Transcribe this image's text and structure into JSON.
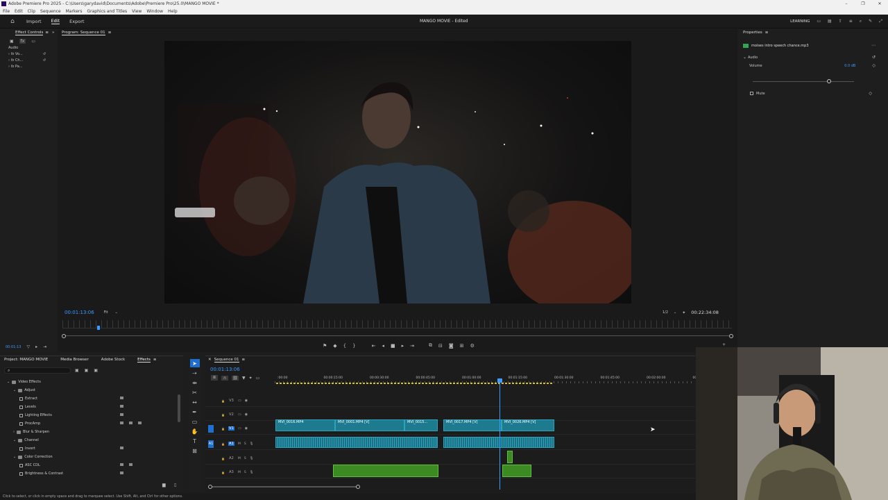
{
  "window": {
    "title": "Adobe Premiere Pro 2025 - C:\\Users\\garydavid\\Documents\\Adobe\\Premiere Pro\\25.0\\MANGO MOVIE *"
  },
  "menu": [
    "File",
    "Edit",
    "Clip",
    "Sequence",
    "Markers",
    "Graphics and Titles",
    "View",
    "Window",
    "Help"
  ],
  "workspace": {
    "tabs": [
      "Import",
      "Edit",
      "Export"
    ],
    "active_tab": "Edit",
    "project_title": "MANGO MOVIE - Edited",
    "learning_label": "LEARNING"
  },
  "effect_controls": {
    "tab_label": "Effect Controls",
    "section_audio": "Audio",
    "items": [
      "Vo...",
      "Ch...",
      "Pa..."
    ],
    "timecode": "00:01:13"
  },
  "program_monitor": {
    "tab_label": "Program: Sequence 01",
    "timecode_current": "00:01:13:06",
    "fit_label": "Fit",
    "resolution_label": "1/2",
    "timecode_duration": "00:22:34:08"
  },
  "properties": {
    "tab_label": "Properties",
    "file_name": "moises intro speech chance.mp3",
    "section_audio": "Audio",
    "volume_label": "Volume",
    "volume_value": "0.0 dB",
    "volume_level_fraction": 0.75,
    "mute_label": "Mute"
  },
  "project_panel": {
    "tabs": [
      "Project: MANGO MOVIE",
      "Media Browser",
      "Adobe Stock",
      "Effects"
    ],
    "active_tab": "Effects",
    "tree": [
      {
        "label": "Video Effects",
        "level": 0,
        "type": "folder"
      },
      {
        "label": "Adjust",
        "level": 1,
        "type": "folder"
      },
      {
        "label": "Extract",
        "level": 2,
        "type": "effect"
      },
      {
        "label": "Levels",
        "level": 2,
        "type": "effect"
      },
      {
        "label": "Lighting Effects",
        "level": 2,
        "type": "effect"
      },
      {
        "label": "ProcAmp",
        "level": 2,
        "type": "effect"
      },
      {
        "label": "Blur & Sharpen",
        "level": 1,
        "type": "folder"
      },
      {
        "label": "Channel",
        "level": 1,
        "type": "folder"
      },
      {
        "label": "Invert",
        "level": 2,
        "type": "effect"
      },
      {
        "label": "Color Correction",
        "level": 1,
        "type": "folder"
      },
      {
        "label": "ASC CDL",
        "level": 2,
        "type": "effect"
      },
      {
        "label": "Brightness & Contrast",
        "level": 2,
        "type": "effect"
      }
    ]
  },
  "timeline": {
    "tab_label": "Sequence 01",
    "timecode": "00:01:13:06",
    "ruler": [
      ":00:00",
      "00:00:15:00",
      "00:00:30:00",
      "00:00:45:00",
      "00:01:00:00",
      "00:01:15:00",
      "00:01:30:00",
      "00:01:45:00",
      "00:02:00:00",
      "00:02:15"
    ],
    "tracks": [
      "V3",
      "V2",
      "V1",
      "A1",
      "A2",
      "A3"
    ],
    "video_clips": [
      "MVI_0016.MP4",
      "MVI_0001.MP4 [V]",
      "MVI_0015...",
      "MVI_0017.MP4 [V]",
      "fx",
      "MVI_0026.MP4 [V]"
    ]
  },
  "status_bar": {
    "text": "Click to select, or click in empty space and drag to marquee select. Use Shift, Alt, and Ctrl for other options."
  }
}
